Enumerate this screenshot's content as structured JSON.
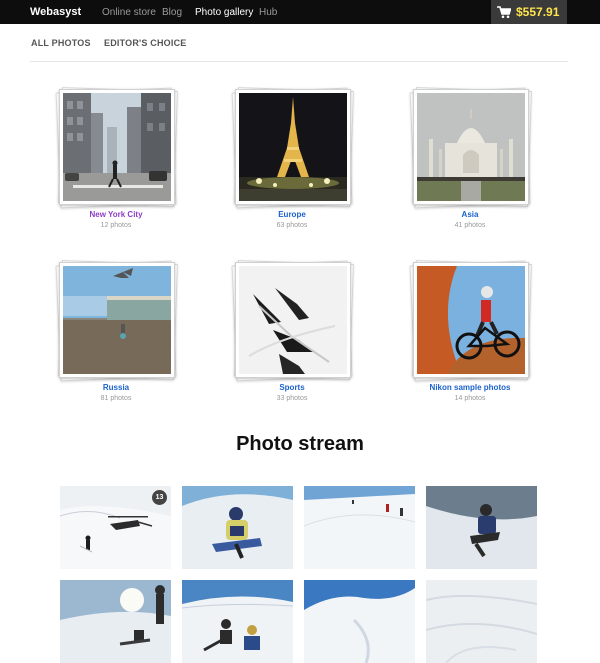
{
  "topbar": {
    "brand": "Webasyst",
    "nav": [
      "Online store",
      "Blog",
      "Photo gallery",
      "Hub"
    ],
    "active_nav": "Photo gallery",
    "cart_total": "$557.91",
    "cart_total_color": "#ffe44d"
  },
  "tabs": [
    "ALL PHOTOS",
    "EDITOR'S CHOICE"
  ],
  "albums": [
    {
      "name": "New York City",
      "count": "12 photos",
      "link_color": "#8a3fc4",
      "icon": "city-street-photo"
    },
    {
      "name": "Europe",
      "count": "63 photos",
      "link_color": "#1a62cc",
      "icon": "eiffel-tower-photo"
    },
    {
      "name": "Asia",
      "count": "41 photos",
      "link_color": "#1a62cc",
      "icon": "taj-mahal-photo"
    },
    {
      "name": "Russia",
      "count": "81 photos",
      "link_color": "#1a62cc",
      "icon": "palace-square-photo"
    },
    {
      "name": "Sports",
      "count": "33 photos",
      "link_color": "#1a62cc",
      "icon": "snowboard-photo"
    },
    {
      "name": "Nikon sample photos",
      "count": "14 photos",
      "link_color": "#1a62cc",
      "icon": "mountain-bike-photo"
    }
  ],
  "stream": {
    "title": "Photo stream",
    "badge_count": "13",
    "photos": [
      {
        "icon": "helicopter-snow-photo"
      },
      {
        "icon": "snowboarder-photo"
      },
      {
        "icon": "ski-slope-photo"
      },
      {
        "icon": "snowboarder-jump-photo"
      },
      {
        "icon": "sun-snowboarder-photo"
      },
      {
        "icon": "snowboarders-group-photo"
      },
      {
        "icon": "snow-ridge-photo"
      },
      {
        "icon": "snow-texture-photo"
      }
    ]
  }
}
